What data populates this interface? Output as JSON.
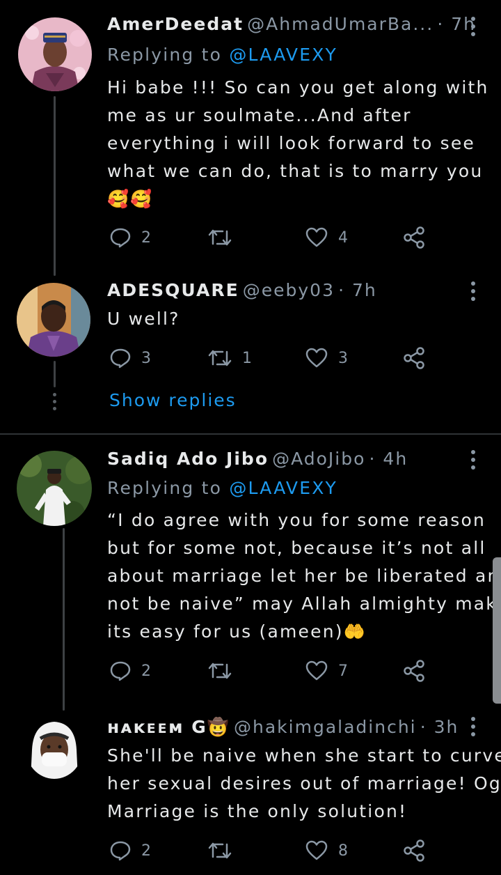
{
  "tweets": [
    {
      "name": "AmerDeedat",
      "handle": "@AhmadUmarBa...",
      "time": "· 7h",
      "replying_prefix": "Replying to",
      "replying_to": "@LAAVEXY",
      "lines": [
        "Hi babe !!! So can you get along with",
        "me as ur soulmate...And after",
        "everything i will look forward to see",
        "what we can do, that is to marry you",
        "🥰🥰"
      ],
      "replies": "2",
      "retweets": "",
      "likes": "4"
    },
    {
      "name": "ADESQUARE",
      "handle": "@eeby03",
      "time": "· 7h",
      "lines": [
        "U well?"
      ],
      "replies": "3",
      "retweets": "1",
      "likes": "3"
    },
    {
      "name": "Sadiq Ado Jibo",
      "handle": "@AdoJibo",
      "time": "· 4h",
      "replying_prefix": "Replying to",
      "replying_to": "@LAAVEXY",
      "lines": [
        "“I do agree with you for some reason",
        "but for some not, because it’s not all",
        "about marriage let her be liberated and",
        "not be naive” may Allah almighty make",
        "its easy for us (ameen)🤲"
      ],
      "replies": "2",
      "retweets": "",
      "likes": "7"
    },
    {
      "name": "ʜᴀᴋᴇᴇᴍ G🤠",
      "handle": "@hakimgaladinchi",
      "time": "· 3h",
      "lines": [
        "She'll be naive when she start to curve",
        "her sexual desires out of marriage! Oga",
        "Marriage is the only solution!"
      ],
      "replies": "2",
      "retweets": "",
      "likes": "8"
    }
  ],
  "show_replies": "Show replies",
  "icons": {
    "reply": "reply-icon",
    "retweet": "retweet-icon",
    "like": "heart-icon",
    "share": "share-icon",
    "more": "more-vertical-icon"
  },
  "colors": {
    "background": "#000000",
    "text": "#e7e9ea",
    "secondary": "#8b98a5",
    "accent": "#1d9bf0"
  }
}
